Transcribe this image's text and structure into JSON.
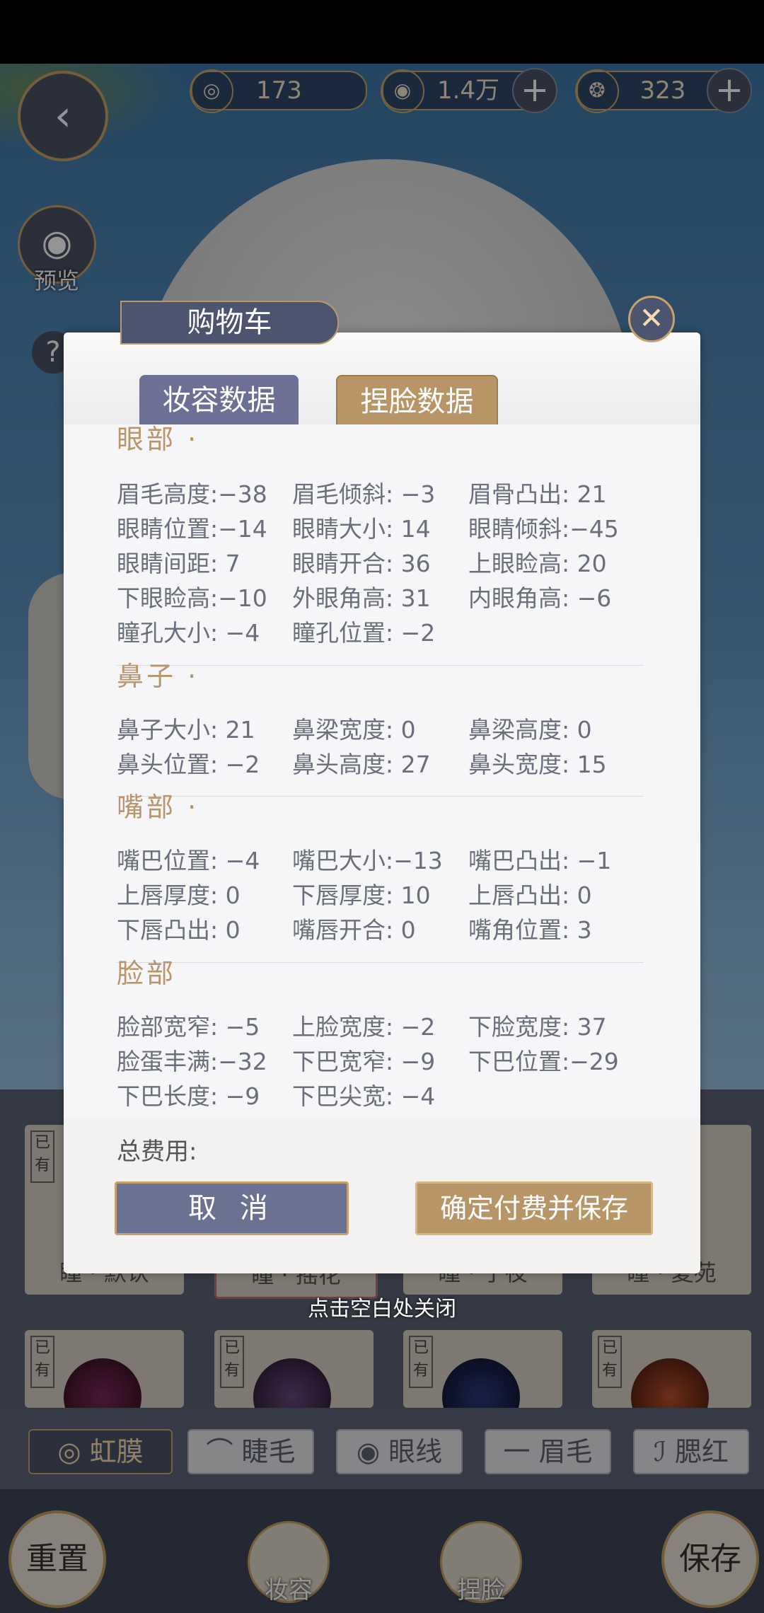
{
  "currency": [
    {
      "icon": "silver-coin-icon",
      "value": "173"
    },
    {
      "icon": "gold-coin-icon",
      "value": "1.4万",
      "plus": "+"
    },
    {
      "icon": "jade-icon",
      "value": "323",
      "plus": "+"
    }
  ],
  "left_buttons": {
    "preview_label": "预览",
    "help": "?"
  },
  "cart": {
    "title": "购物车",
    "close": "✕",
    "tabs": [
      "妆容数据",
      "捏脸数据"
    ],
    "sections": [
      {
        "title": "眼部 ·",
        "items": [
          "眉毛高度:−38",
          "眉毛倾斜: −3",
          "眉骨凸出: 21",
          "眼睛位置:−14",
          "眼睛大小: 14",
          "眼睛倾斜:−45",
          "眼睛间距:  7",
          "眼睛开合: 36",
          "上眼睑高: 20",
          "下眼睑高:−10",
          "外眼角高: 31",
          "内眼角高: −6",
          "瞳孔大小: −4",
          "瞳孔位置: −2"
        ]
      },
      {
        "title": "鼻子 ·",
        "items": [
          "鼻子大小: 21",
          "鼻梁宽度:  0",
          "鼻梁高度:  0",
          "鼻头位置: −2",
          "鼻头高度: 27",
          "鼻头宽度: 15"
        ]
      },
      {
        "title": "嘴部 ·",
        "items": [
          "嘴巴位置: −4",
          "嘴巴大小:−13",
          "嘴巴凸出: −1",
          "上唇厚度:  0",
          "下唇厚度: 10",
          "上唇凸出:  0",
          "下唇凸出:  0",
          "嘴唇开合:  0",
          "嘴角位置:  3"
        ]
      },
      {
        "title": "脸部",
        "items": [
          "脸部宽窄: −5",
          "上脸宽度: −2",
          "下脸宽度: 37",
          "脸蛋丰满:−32",
          "下巴宽窄: −9",
          "下巴位置:−29",
          "下巴长度: −9",
          "下巴尖宽: −4"
        ]
      }
    ],
    "fee_label": "总费用:",
    "cancel": "取 消",
    "confirm": "确定付费并保存"
  },
  "tap_close": "点击空白处关闭",
  "cards_row1": [
    "瞳 · 默认",
    "瞳 · 摇花",
    "瞳 · 子夜",
    "瞳 · 夏苑"
  ],
  "owned_tag": "已有",
  "category_tabs": [
    "◎ 虹膜",
    "⌒ 睫毛",
    "◉ 眼线",
    "一 眉毛",
    "ℐ 腮红"
  ],
  "bottom": {
    "reset": "重置",
    "makeup": "妆容",
    "face": "捏脸",
    "save": "保存"
  },
  "colors": {
    "accent_gold": "#c7a36b",
    "panel_purple": "#6b7094",
    "section_title": "#b8956a"
  }
}
